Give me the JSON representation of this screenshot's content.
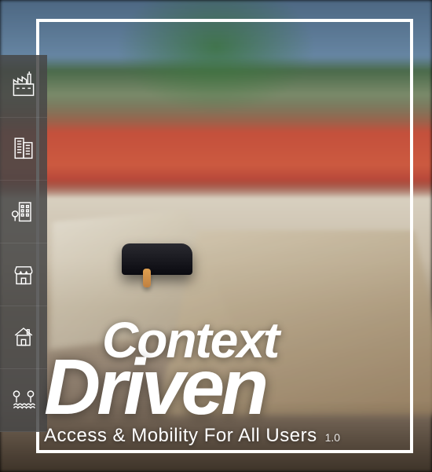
{
  "title": {
    "line1": "Context",
    "line2": "Driven"
  },
  "subtitle": "Access & Mobility For All Users",
  "version": "1.0",
  "sidebar": {
    "items": [
      {
        "name": "industrial-icon"
      },
      {
        "name": "urban-highrise-icon"
      },
      {
        "name": "midrise-tree-icon"
      },
      {
        "name": "town-market-icon"
      },
      {
        "name": "single-house-icon"
      },
      {
        "name": "rural-crops-icon"
      }
    ]
  }
}
